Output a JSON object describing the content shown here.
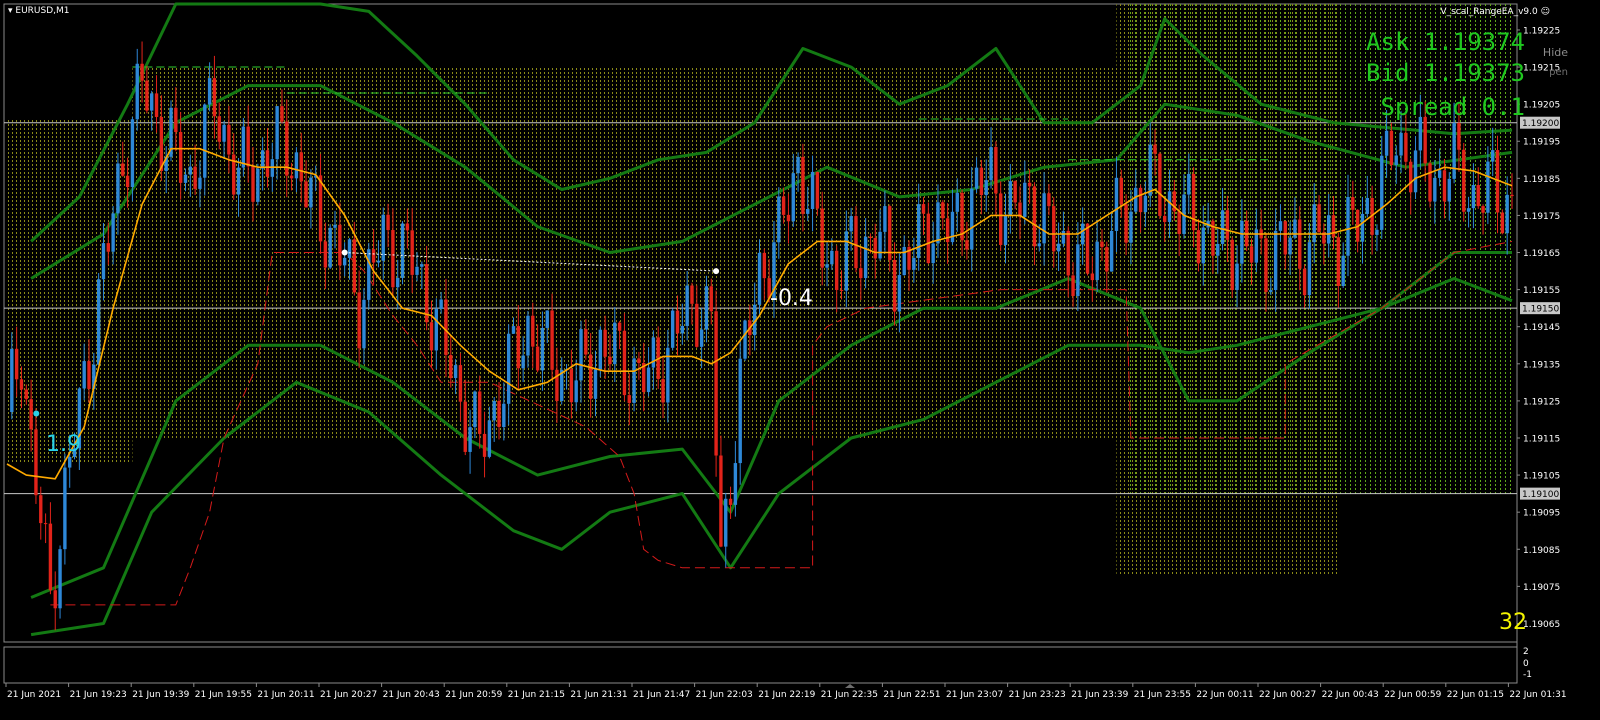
{
  "window": {
    "symbol": "EURUSD,M1",
    "ea_name": "V_scal_RangeEA_v9.0",
    "hide_label": "Hide",
    "pen_label": "pen",
    "bar_count": "32"
  },
  "hud": {
    "ask": "Ask 1.19374",
    "bid": "Bid 1.19373",
    "spread": "Spread 0.1"
  },
  "colors": {
    "bull": "#2e88d8",
    "bear": "#e2231a",
    "ma": "#ffaa00",
    "band": "#137a13",
    "zone_olive": "#8a8a18",
    "zone_green": "#5fa81a",
    "trail": "#d41a1a",
    "hud_text": "#1fc81f"
  },
  "chart_data": {
    "type": "candlestick",
    "ylim": [
      1.1906,
      1.19232
    ],
    "y_ticks": [
      "1.19225",
      "1.19215",
      "1.19205",
      "1.19195",
      "1.19185",
      "1.19175",
      "1.19165",
      "1.19155",
      "1.19145",
      "1.19135",
      "1.19125",
      "1.19115",
      "1.19105",
      "1.19095",
      "1.19085",
      "1.19075",
      "1.19065"
    ],
    "price_levels": [
      {
        "label": "1.19200",
        "price": 1.192
      },
      {
        "label": "1.19150",
        "price": 1.1915
      },
      {
        "label": "1.19100",
        "price": 1.191
      }
    ],
    "x_ticks": [
      "21 Jun 2021",
      "21 Jun 19:23",
      "21 Jun 19:39",
      "21 Jun 19:55",
      "21 Jun 20:11",
      "21 Jun 20:27",
      "21 Jun 20:43",
      "21 Jun 20:59",
      "21 Jun 21:15",
      "21 Jun 21:31",
      "21 Jun 21:47",
      "21 Jun 22:03",
      "21 Jun 22:19",
      "21 Jun 22:35",
      "21 Jun 22:51",
      "21 Jun 23:07",
      "21 Jun 23:23",
      "21 Jun 23:39",
      "21 Jun 23:55",
      "22 Jun 00:11",
      "22 Jun 00:27",
      "22 Jun 00:43",
      "22 Jun 00:59",
      "22 Jun 01:15",
      "22 Jun 01:31"
    ],
    "close_path": [
      [
        0,
        1.19122
      ],
      [
        3,
        1.1914
      ],
      [
        5,
        1.19112
      ],
      [
        9,
        1.19072
      ],
      [
        12,
        1.191
      ],
      [
        18,
        1.19145
      ],
      [
        24,
        1.1919
      ],
      [
        28,
        1.1921
      ],
      [
        33,
        1.19195
      ],
      [
        38,
        1.19185
      ],
      [
        43,
        1.19205
      ],
      [
        48,
        1.19185
      ],
      [
        53,
        1.1919
      ],
      [
        58,
        1.19195
      ],
      [
        63,
        1.19178
      ],
      [
        68,
        1.19168
      ],
      [
        73,
        1.19152
      ],
      [
        78,
        1.19168
      ],
      [
        83,
        1.19165
      ],
      [
        88,
        1.1915
      ],
      [
        93,
        1.1913
      ],
      [
        98,
        1.19112
      ],
      [
        103,
        1.1913
      ],
      [
        108,
        1.19145
      ],
      [
        113,
        1.19135
      ],
      [
        118,
        1.1913
      ],
      [
        123,
        1.1914
      ],
      [
        128,
        1.19135
      ],
      [
        133,
        1.1913
      ],
      [
        138,
        1.19142
      ],
      [
        143,
        1.19152
      ],
      [
        146,
        1.19145
      ],
      [
        148,
        1.19082
      ],
      [
        152,
        1.1913
      ],
      [
        156,
        1.1916
      ],
      [
        160,
        1.19168
      ],
      [
        164,
        1.1919
      ],
      [
        168,
        1.1917
      ],
      [
        172,
        1.1916
      ],
      [
        176,
        1.19165
      ],
      [
        180,
        1.1917
      ],
      [
        184,
        1.1916
      ],
      [
        188,
        1.19165
      ],
      [
        192,
        1.19175
      ],
      [
        196,
        1.1917
      ],
      [
        200,
        1.1918
      ],
      [
        204,
        1.19185
      ],
      [
        208,
        1.19175
      ],
      [
        212,
        1.1918
      ],
      [
        216,
        1.1917
      ],
      [
        220,
        1.19165
      ],
      [
        224,
        1.1916
      ],
      [
        228,
        1.1917
      ],
      [
        232,
        1.19175
      ],
      [
        236,
        1.19185
      ],
      [
        240,
        1.1918
      ],
      [
        244,
        1.19175
      ],
      [
        248,
        1.19172
      ],
      [
        252,
        1.19165
      ],
      [
        256,
        1.19168
      ],
      [
        260,
        1.19162
      ],
      [
        264,
        1.19168
      ],
      [
        268,
        1.19165
      ],
      [
        272,
        1.1917
      ],
      [
        276,
        1.19168
      ],
      [
        280,
        1.19172
      ],
      [
        284,
        1.1918
      ],
      [
        288,
        1.19195
      ],
      [
        292,
        1.1919
      ],
      [
        296,
        1.19185
      ],
      [
        300,
        1.19188
      ],
      [
        304,
        1.1918
      ],
      [
        308,
        1.19182
      ],
      [
        312,
        1.19178
      ]
    ],
    "ma_path": [
      [
        0,
        1.19108
      ],
      [
        4,
        1.19105
      ],
      [
        10,
        1.19104
      ],
      [
        16,
        1.19118
      ],
      [
        22,
        1.1915
      ],
      [
        28,
        1.19178
      ],
      [
        34,
        1.19193
      ],
      [
        40,
        1.19193
      ],
      [
        46,
        1.1919
      ],
      [
        52,
        1.19188
      ],
      [
        58,
        1.19188
      ],
      [
        64,
        1.19186
      ],
      [
        70,
        1.19175
      ],
      [
        76,
        1.1916
      ],
      [
        82,
        1.1915
      ],
      [
        88,
        1.19148
      ],
      [
        94,
        1.1914
      ],
      [
        100,
        1.19133
      ],
      [
        106,
        1.19128
      ],
      [
        112,
        1.1913
      ],
      [
        118,
        1.19135
      ],
      [
        124,
        1.19133
      ],
      [
        130,
        1.19133
      ],
      [
        136,
        1.19137
      ],
      [
        142,
        1.19137
      ],
      [
        146,
        1.19135
      ],
      [
        150,
        1.19138
      ],
      [
        156,
        1.19148
      ],
      [
        162,
        1.19162
      ],
      [
        168,
        1.19168
      ],
      [
        174,
        1.19168
      ],
      [
        180,
        1.19165
      ],
      [
        186,
        1.19165
      ],
      [
        192,
        1.19168
      ],
      [
        198,
        1.1917
      ],
      [
        204,
        1.19175
      ],
      [
        210,
        1.19175
      ],
      [
        216,
        1.1917
      ],
      [
        222,
        1.1917
      ],
      [
        228,
        1.19175
      ],
      [
        234,
        1.1918
      ],
      [
        238,
        1.19182
      ],
      [
        244,
        1.19175
      ],
      [
        250,
        1.19172
      ],
      [
        256,
        1.1917
      ],
      [
        262,
        1.1917
      ],
      [
        268,
        1.1917
      ],
      [
        274,
        1.1917
      ],
      [
        280,
        1.19172
      ],
      [
        286,
        1.19178
      ],
      [
        292,
        1.19185
      ],
      [
        298,
        1.19188
      ],
      [
        304,
        1.19187
      ],
      [
        312,
        1.19183
      ]
    ],
    "bands": {
      "upper_outer": [
        [
          5,
          1.19168
        ],
        [
          15,
          1.1918
        ],
        [
          25,
          1.19205
        ],
        [
          35,
          1.19232
        ],
        [
          45,
          1.19232
        ],
        [
          55,
          1.19232
        ],
        [
          65,
          1.19232
        ],
        [
          75,
          1.1923
        ],
        [
          85,
          1.19218
        ],
        [
          95,
          1.19205
        ],
        [
          105,
          1.1919
        ],
        [
          115,
          1.19182
        ],
        [
          125,
          1.19185
        ],
        [
          135,
          1.1919
        ],
        [
          145,
          1.19192
        ],
        [
          155,
          1.192
        ],
        [
          165,
          1.1922
        ],
        [
          175,
          1.19215
        ],
        [
          185,
          1.19205
        ],
        [
          195,
          1.1921
        ],
        [
          205,
          1.1922
        ],
        [
          215,
          1.192
        ],
        [
          225,
          1.192
        ],
        [
          235,
          1.1921
        ],
        [
          240,
          1.19228
        ],
        [
          248,
          1.19218
        ],
        [
          260,
          1.19205
        ],
        [
          275,
          1.192
        ],
        [
          300,
          1.19197
        ],
        [
          312,
          1.19198
        ]
      ],
      "upper_inner": [
        [
          5,
          1.19158
        ],
        [
          20,
          1.1917
        ],
        [
          35,
          1.192
        ],
        [
          50,
          1.1921
        ],
        [
          65,
          1.1921
        ],
        [
          80,
          1.192
        ],
        [
          95,
          1.19188
        ],
        [
          110,
          1.19172
        ],
        [
          125,
          1.19165
        ],
        [
          140,
          1.19168
        ],
        [
          155,
          1.19178
        ],
        [
          170,
          1.19188
        ],
        [
          185,
          1.1918
        ],
        [
          200,
          1.19182
        ],
        [
          215,
          1.19188
        ],
        [
          230,
          1.1919
        ],
        [
          240,
          1.19205
        ],
        [
          255,
          1.19202
        ],
        [
          270,
          1.19195
        ],
        [
          290,
          1.19188
        ],
        [
          312,
          1.19192
        ]
      ],
      "lower_inner": [
        [
          5,
          1.19072
        ],
        [
          20,
          1.1908
        ],
        [
          35,
          1.19125
        ],
        [
          50,
          1.1914
        ],
        [
          65,
          1.1914
        ],
        [
          80,
          1.1913
        ],
        [
          95,
          1.19115
        ],
        [
          110,
          1.19105
        ],
        [
          125,
          1.1911
        ],
        [
          140,
          1.19112
        ],
        [
          150,
          1.19095
        ],
        [
          160,
          1.19125
        ],
        [
          175,
          1.1914
        ],
        [
          190,
          1.1915
        ],
        [
          205,
          1.1915
        ],
        [
          220,
          1.19158
        ],
        [
          235,
          1.1915
        ],
        [
          245,
          1.19125
        ],
        [
          255,
          1.19125
        ],
        [
          270,
          1.19138
        ],
        [
          285,
          1.1915
        ],
        [
          300,
          1.19165
        ],
        [
          312,
          1.19165
        ]
      ],
      "lower_outer": [
        [
          5,
          1.19062
        ],
        [
          20,
          1.19065
        ],
        [
          30,
          1.19095
        ],
        [
          45,
          1.19115
        ],
        [
          60,
          1.1913
        ],
        [
          75,
          1.19122
        ],
        [
          90,
          1.19105
        ],
        [
          105,
          1.1909
        ],
        [
          115,
          1.19085
        ],
        [
          125,
          1.19095
        ],
        [
          140,
          1.191
        ],
        [
          150,
          1.1908
        ],
        [
          160,
          1.191
        ],
        [
          175,
          1.19115
        ],
        [
          190,
          1.1912
        ],
        [
          205,
          1.1913
        ],
        [
          220,
          1.1914
        ],
        [
          235,
          1.1914
        ],
        [
          245,
          1.19138
        ],
        [
          255,
          1.1914
        ],
        [
          270,
          1.19145
        ],
        [
          285,
          1.1915
        ],
        [
          300,
          1.19158
        ],
        [
          312,
          1.19152
        ]
      ]
    },
    "zones": [
      {
        "x0": 0,
        "x1": 26,
        "y_top": 1.19201,
        "y_bottom": 1.19108,
        "color": "zone_olive"
      },
      {
        "x0": 26,
        "x1": 239,
        "y_top": 1.19215,
        "y_bottom": 1.19115,
        "color": "zone_olive"
      },
      {
        "x0": 230,
        "x1": 276,
        "y_top": 1.19232,
        "y_bottom": 1.19078,
        "color": "zone_olive"
      },
      {
        "x0": 232,
        "x1": 312,
        "y_top": 1.19232,
        "y_bottom": 1.191,
        "color": "zone_green"
      }
    ],
    "range_lines": [
      {
        "x0": 26,
        "x1": 58,
        "y": 1.19215,
        "color": "#2ecc2e"
      },
      {
        "x0": 58,
        "x1": 100,
        "y": 1.19208,
        "color": "#2ecc2e"
      },
      {
        "x0": 189,
        "x1": 220,
        "y": 1.19201,
        "color": "#2ecc2e"
      },
      {
        "x0": 220,
        "x1": 262,
        "y": 1.1919,
        "color": "#2ecc2e"
      }
    ],
    "trail_stop": [
      [
        9,
        1.1907
      ],
      [
        30,
        1.1907
      ],
      [
        35,
        1.1907
      ],
      [
        38,
        1.1908
      ],
      [
        42,
        1.19095
      ],
      [
        45,
        1.19115
      ],
      [
        52,
        1.19135
      ],
      [
        55,
        1.19165
      ],
      [
        70,
        1.19165
      ],
      [
        74,
        1.1916
      ],
      [
        80,
        1.19148
      ],
      [
        85,
        1.1914
      ],
      [
        90,
        1.1913
      ],
      [
        100,
        1.1913
      ],
      [
        120,
        1.19118
      ],
      [
        127,
        1.1911
      ],
      [
        130,
        1.191
      ],
      [
        132,
        1.19085
      ],
      [
        135,
        1.19082
      ],
      [
        140,
        1.1908
      ],
      [
        148,
        1.1908
      ],
      [
        167,
        1.1908
      ],
      [
        167,
        1.1914
      ],
      [
        170,
        1.19145
      ],
      [
        178,
        1.1915
      ],
      [
        206,
        1.19155
      ],
      [
        232,
        1.19155
      ],
      [
        233,
        1.19115
      ],
      [
        265,
        1.19115
      ],
      [
        265,
        1.19135
      ],
      [
        285,
        1.1915
      ],
      [
        300,
        1.19165
      ],
      [
        312,
        1.19168
      ]
    ],
    "trade_line": {
      "x0": 70,
      "y0": 1.19165,
      "x1": 147,
      "y1": 1.1916
    },
    "annotations": [
      {
        "text": "1.9",
        "x": 4,
        "y": 1.1912
      },
      {
        "text": "-0.4",
        "x": 147,
        "y": 1.19157
      }
    ],
    "subwindow": {
      "ticks": [
        "2",
        "0",
        "-1"
      ]
    }
  }
}
